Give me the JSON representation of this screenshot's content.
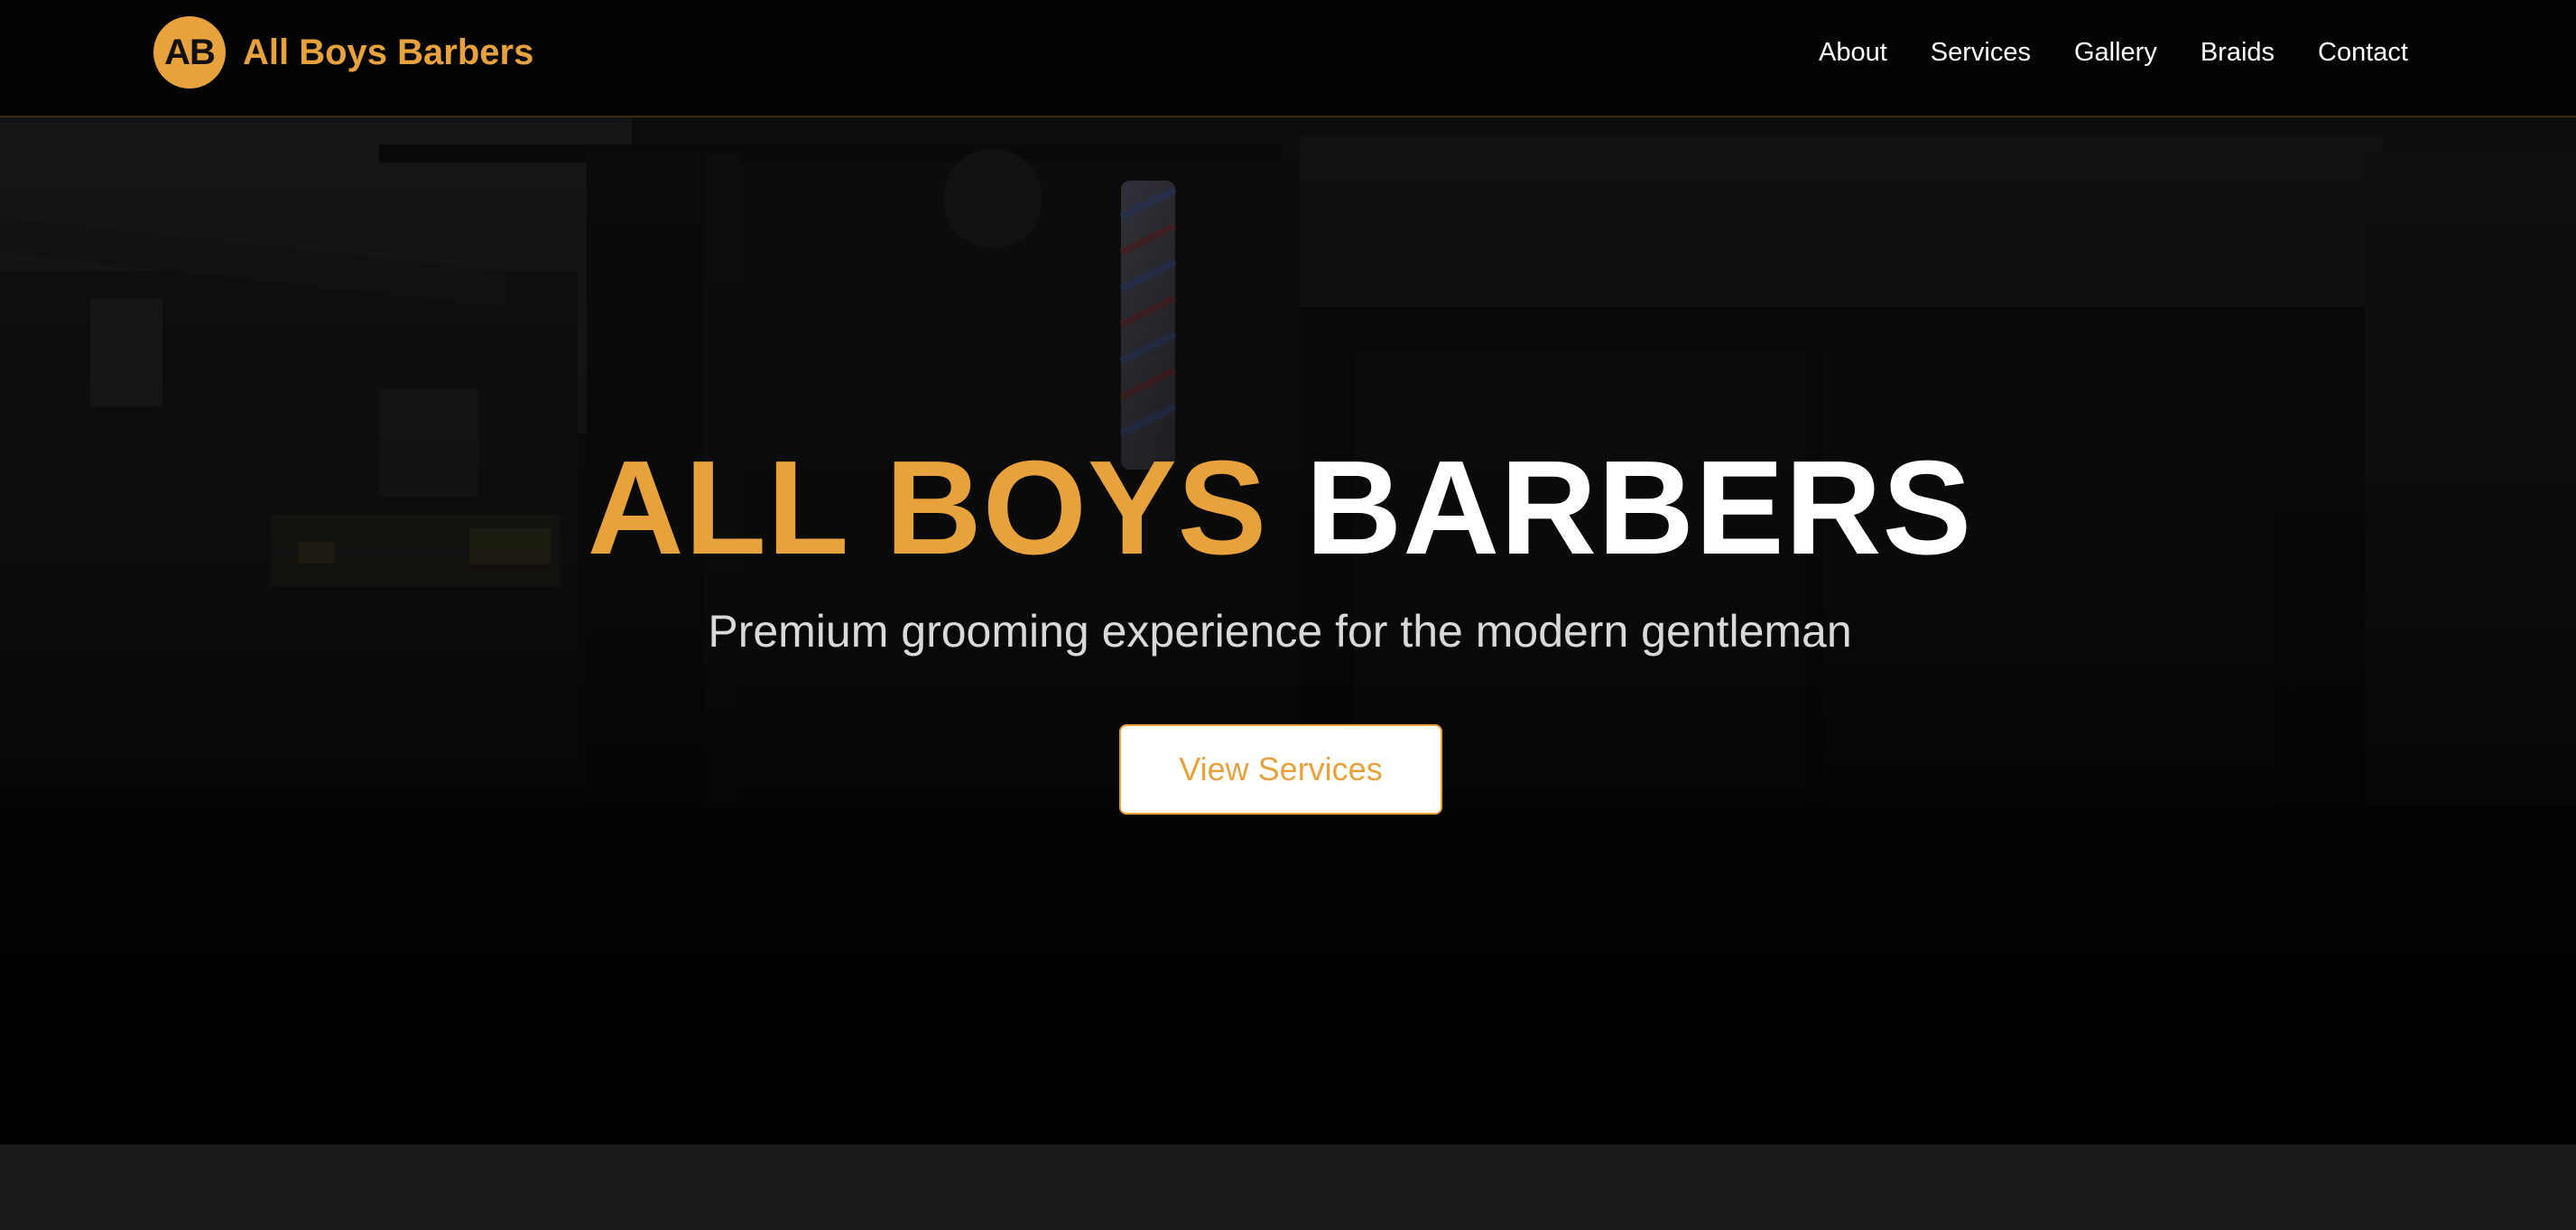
{
  "header": {
    "logo_initials": "AB",
    "brand_name": "All Boys Barbers",
    "nav": [
      "About",
      "Services",
      "Gallery",
      "Braids",
      "Contact"
    ]
  },
  "hero": {
    "title_accent": "ALL BOYS",
    "title_rest": "BARBERS",
    "subtitle": "Premium grooming experience for the modern gentleman",
    "cta_label": "View Services",
    "background_image": "barber-shop-storefront-photo"
  },
  "colors": {
    "accent": "#e8a23d",
    "navbar_bg": "#030303",
    "section_bg": "#1a1a1b",
    "text_light": "#ffffff"
  }
}
